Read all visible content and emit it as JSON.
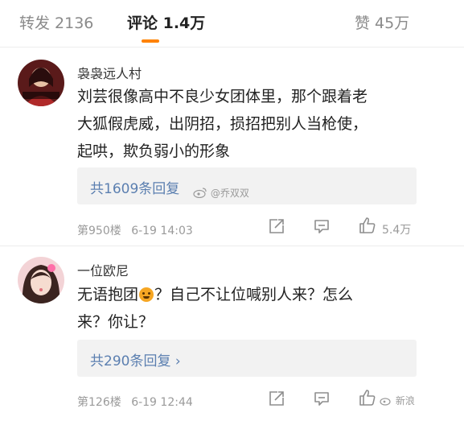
{
  "tabs": {
    "repost": "转发 2136",
    "comments": "评论 1.4万",
    "likes": "赞 45万"
  },
  "comments": [
    {
      "username": "袅袅远人村",
      "avatar_icon": "avatar-image",
      "lines": [
        "刘芸很像高中不良少女团体里，那个跟着老",
        "大狐假虎威，出阴招，损招把别人当枪使，",
        "起哄，欺负弱小的形象"
      ],
      "replies_label": "共1609条回复",
      "watermark": "@乔双双",
      "floor": "第950楼",
      "time": "6-19 14:03",
      "like_count": "5.4万"
    },
    {
      "username": "一位欧尼",
      "avatar_icon": "avatar-image",
      "line1_pre": "无语抱团",
      "line1_post": "？自己不让位喊别人来？怎么",
      "line2": "来？你让？",
      "emoji": "dog-face-emoji",
      "replies_label": "共290条回复 ›",
      "watermark": "新浪",
      "floor": "第126楼",
      "time": "6-19 12:44",
      "like_count": ""
    }
  ],
  "colors": {
    "accent": "#ff8200",
    "link": "#5b7fb0",
    "meta": "#9a9a9a"
  }
}
